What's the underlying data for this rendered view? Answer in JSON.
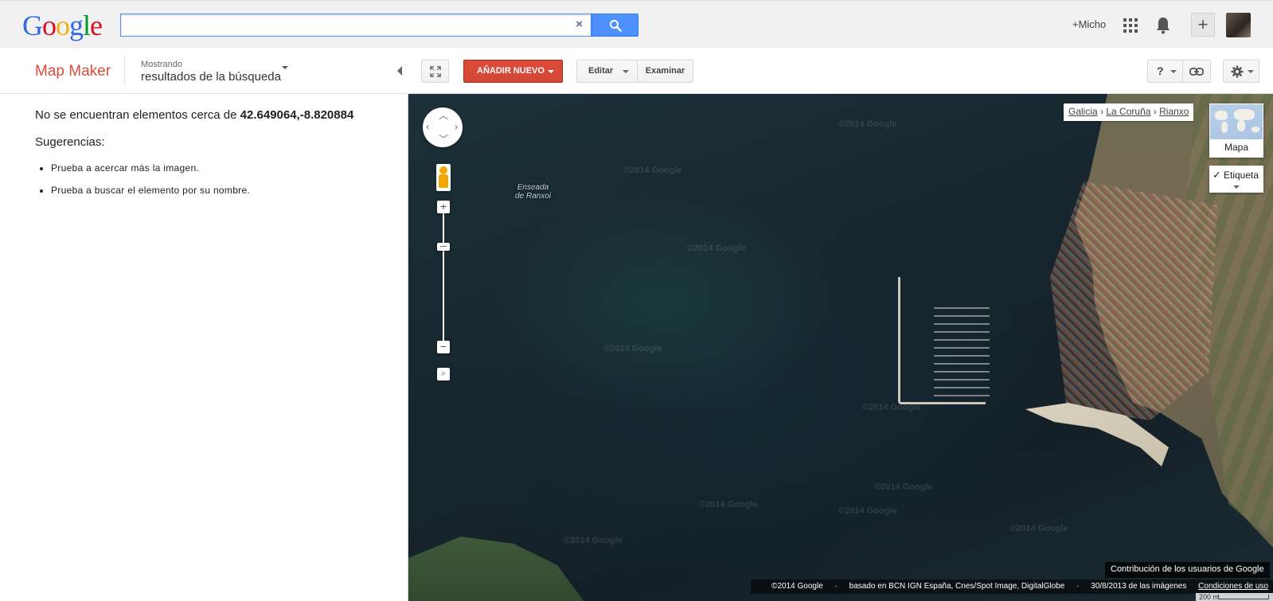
{
  "header": {
    "logo_letters": [
      {
        "char": "G",
        "color": "#3369e8"
      },
      {
        "char": "o",
        "color": "#d50f25"
      },
      {
        "char": "o",
        "color": "#eeb211"
      },
      {
        "char": "g",
        "color": "#3369e8"
      },
      {
        "char": "l",
        "color": "#009925"
      },
      {
        "char": "e",
        "color": "#d50f25"
      }
    ],
    "search": {
      "value": "",
      "placeholder": "",
      "clear_label": "×"
    },
    "user_link": "+Micho",
    "share_label": "+"
  },
  "subheader": {
    "app_title": "Map Maker",
    "showing_label": "Mostrando",
    "showing_value": "resultados de la búsqueda"
  },
  "left_panel": {
    "no_results_prefix": "No se encuentran elementos cerca de ",
    "coordinates": "42.649064,-8.820884",
    "suggestions_title": "Sugerencias:",
    "suggestions": [
      "Prueba a acercar más la imagen.",
      "Prueba a buscar el elemento por su nombre."
    ]
  },
  "toolbar": {
    "add_new_label": "AÑADIR NUEVO",
    "edit_label": "Editar",
    "examine_label": "Examinar",
    "help_label": "?"
  },
  "map": {
    "place_label_line1": "Enseada",
    "place_label_line2": "de Ranxoi",
    "watermark_text": "©2014 Google",
    "breadcrumb": [
      "Galicia",
      "La Coruña",
      "Rianxo"
    ],
    "breadcrumb_separator": "›",
    "minimap_label": "Mapa",
    "labels_toggle_label": "Etiqueta",
    "labels_checked": true,
    "user_contrib": "Contribución de los usuarios de Google",
    "attribution": {
      "copyright": "©2014 Google",
      "sep": "·",
      "data_source": "basado en BCN IGN España, Cnes/Spot Image, DigitalGlobe",
      "imagery_date": "30/8/2013 de las imágenes",
      "terms_link": "Condiciones de uso"
    },
    "scale_label": "200 m"
  },
  "colors": {
    "accent_red": "#dd4b39",
    "search_blue": "#4d90fe"
  }
}
